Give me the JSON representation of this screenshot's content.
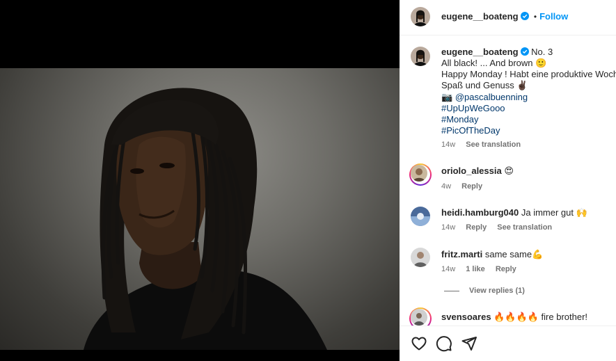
{
  "author": {
    "username": "eugene__boateng",
    "follow_label": "Follow",
    "dot": "•"
  },
  "caption": {
    "username": "eugene__boateng",
    "line1_suffix": "No. 3",
    "line2": "All black! ... And brown 🙂",
    "line3": "Happy Monday ! Habt eine produktive Woche",
    "line4": "Spaß und Genuss ✌🏿",
    "camera_emoji": "📷",
    "mention": "@pascalbuenning",
    "hashtags": [
      "#UpUpWeGooo",
      "#Monday",
      "#PicOfTheDay"
    ],
    "time": "14w",
    "translate_label": "See translation"
  },
  "comments": [
    {
      "username": "oriolo_alessia",
      "text": "😍",
      "time": "4w",
      "likes": "",
      "reply_label": "Reply",
      "translate_label": ""
    },
    {
      "username": "heidi.hamburg040",
      "text": "Ja immer gut 🙌",
      "time": "14w",
      "likes": "",
      "reply_label": "Reply",
      "translate_label": "See translation"
    },
    {
      "username": "fritz.marti",
      "text": "same same💪",
      "time": "14w",
      "likes": "1 like",
      "reply_label": "Reply",
      "translate_label": ""
    },
    {
      "username": "svensoares",
      "text": "🔥🔥🔥🔥 fire brother!",
      "time": "",
      "likes": "",
      "reply_label": "",
      "translate_label": ""
    }
  ],
  "view_replies_label": "View replies (1)",
  "icons": [
    "verified-badge-icon",
    "heart-icon",
    "comment-icon",
    "share-icon"
  ],
  "colors": {
    "accent": "#0095f6",
    "hashtag": "#00376b",
    "muted": "#737373",
    "text": "#262626",
    "media_bg": "#000000"
  }
}
